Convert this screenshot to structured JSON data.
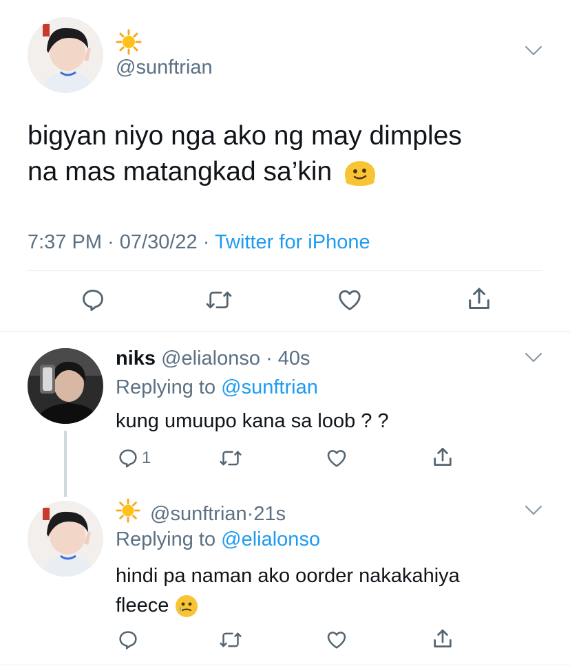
{
  "main_tweet": {
    "display_name_emoji": "☀️",
    "handle": "@sunftrian",
    "text_line1": "bigyan niyo nga ako ng may dimples",
    "text_line2": "na mas matangkad sa’kin",
    "time": "7:37 PM",
    "date": "07/30/22",
    "source": "Twitter for iPhone"
  },
  "reply1": {
    "name": "niks",
    "handle": "@elialonso",
    "age": "40s",
    "replying_to_label": "Replying to",
    "replying_to_handle": "@sunftrian",
    "text": "kung umuupo kana sa loob ? ?",
    "reply_count": "1"
  },
  "reply2": {
    "display_name_emoji": "☀️",
    "handle": "@sunftrian",
    "age": "21s",
    "replying_to_label": "Replying to",
    "replying_to_handle": "@elialonso",
    "text_line1": "hindi pa naman ako oorder nakakahiya",
    "text_line2": "fleece"
  },
  "colors": {
    "text": "#0f1419",
    "muted": "#5b7083",
    "link": "#1d9bf0",
    "divider": "#e6ecf0"
  },
  "icons": [
    "chevron-down-icon",
    "reply-icon",
    "retweet-icon",
    "like-icon",
    "share-icon",
    "sun-emoji",
    "melting-face-emoji",
    "crying-face-emoji"
  ]
}
